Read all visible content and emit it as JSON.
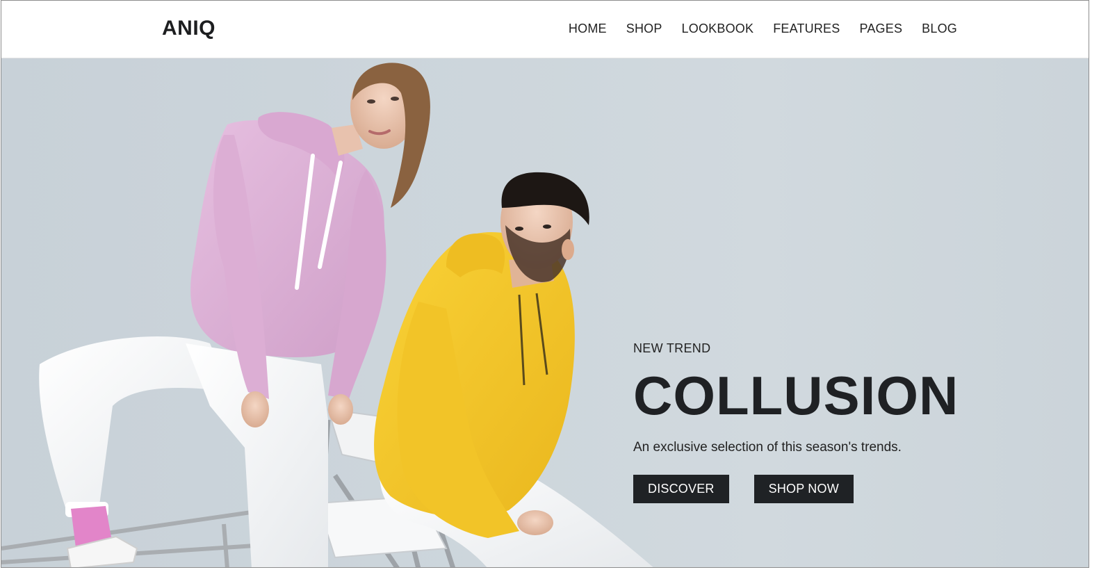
{
  "brand": {
    "logo": "ANIQ"
  },
  "nav": {
    "items": [
      {
        "label": "HOME"
      },
      {
        "label": "SHOP"
      },
      {
        "label": "LOOKBOOK"
      },
      {
        "label": "FEATURES"
      },
      {
        "label": "PAGES"
      },
      {
        "label": "BLOG"
      }
    ]
  },
  "hero": {
    "eyebrow": "NEW TREND",
    "title": "COLLUSION",
    "subtitle": "An exclusive selection of this season's trends.",
    "buttons": {
      "discover": "DISCOVER",
      "shop_now": "SHOP NOW"
    }
  },
  "colors": {
    "background": "#cdd6dc",
    "button": "#1f2225",
    "text": "#1f2124",
    "pink_hoodie": "#e0b6d8",
    "yellow_hoodie": "#f6c62c"
  }
}
